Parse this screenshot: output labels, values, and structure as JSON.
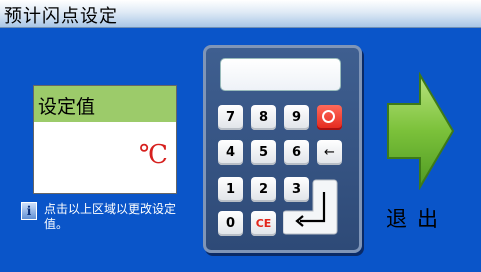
{
  "window": {
    "title": "预计闪点设定"
  },
  "setting_panel": {
    "header": "设定值",
    "unit": "℃"
  },
  "hint": {
    "icon": "info-icon",
    "text": "点击以上区域以更改设定值。"
  },
  "keypad": {
    "rows": [
      [
        "7",
        "8",
        "9",
        "power"
      ],
      [
        "4",
        "5",
        "6",
        "←"
      ],
      [
        "1",
        "2",
        "3"
      ],
      [
        "0",
        "CE"
      ]
    ],
    "power_color": "#e3261b"
  },
  "exit": {
    "label": "退出",
    "arrow_color": "#7bc13a"
  }
}
